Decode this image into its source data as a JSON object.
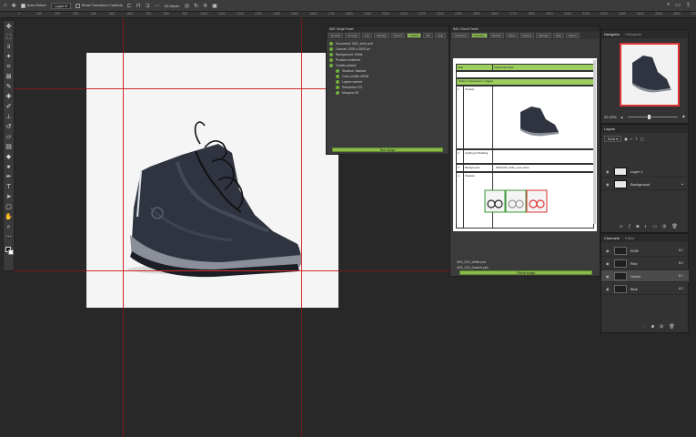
{
  "options_bar": {
    "auto_select_label": "Auto-Select:",
    "auto_select_value": "Layer",
    "transform_label": "Show Transform Controls",
    "mode_label": "3D Mode:"
  },
  "toolbar": {
    "tools": [
      "move-icon",
      "marquee-icon",
      "lasso-icon",
      "magic-wand-icon",
      "crop-icon",
      "frame-icon",
      "eyedropper-icon",
      "healing-icon",
      "brush-icon",
      "stamp-icon",
      "history-brush-icon",
      "eraser-icon",
      "gradient-icon",
      "blur-icon",
      "dodge-icon",
      "pen-icon",
      "type-icon",
      "path-select-icon",
      "shape-icon",
      "hand-icon",
      "zoom-icon",
      "more-icon"
    ]
  },
  "script_panel": {
    "title": "IMG Script Panel",
    "tabs": [
      "Results",
      "Preview",
      "Log",
      "Settings",
      "Actions",
      "Guides",
      "Info",
      "Help"
    ],
    "items": [
      "Document: IMG_shoe.psd",
      "Canvas: 2000 x 2000 px",
      "Background: White",
      "Product centered",
      "Guides placed",
      "Shadow: Natural",
      "Color profile sRGB",
      "Layers named",
      "Resolution OK",
      "Margins OK"
    ],
    "run_button": "Run Script"
  },
  "checklist_panel": {
    "title": "IMG Check Panel",
    "tabs": [
      "Overview",
      "Checklist",
      "Results",
      "Notes",
      "History",
      "Settings",
      "Help",
      "Export"
    ],
    "header_left": "Task",
    "header_right": "Status/Checklist",
    "section": "Order of Operations: Images",
    "rows": [
      "Product",
      "Lighting & Shading",
      "Background",
      "Shadow"
    ],
    "background_text": "#FFFFFF, white, pure white",
    "footer_items": [
      "IMG_001_White.psd",
      "IMG_002_Swatch.psd"
    ],
    "action_button": "Check Image"
  },
  "navigator": {
    "tabs": [
      "Navigator",
      "Histogram"
    ],
    "zoom": "33.33%"
  },
  "layers": {
    "tabs": [
      "Layers"
    ],
    "kind_label": "Kind",
    "items": [
      {
        "name": "Layer 1",
        "selected": false
      },
      {
        "name": "Background",
        "selected": false
      }
    ]
  },
  "channels": {
    "tabs": [
      "Channels",
      "Paths"
    ],
    "items": [
      {
        "name": "RGB",
        "shortcut": "⌘2",
        "selected": false
      },
      {
        "name": "Red",
        "shortcut": "⌘3",
        "selected": false
      },
      {
        "name": "Green",
        "shortcut": "⌘4",
        "selected": true
      },
      {
        "name": "Blue",
        "shortcut": "⌘5",
        "selected": false
      }
    ]
  },
  "colors": {
    "accent_green": "#8dba4f",
    "guide_red": "#d02c2c",
    "canvas_bg": "#f5f5f5"
  }
}
